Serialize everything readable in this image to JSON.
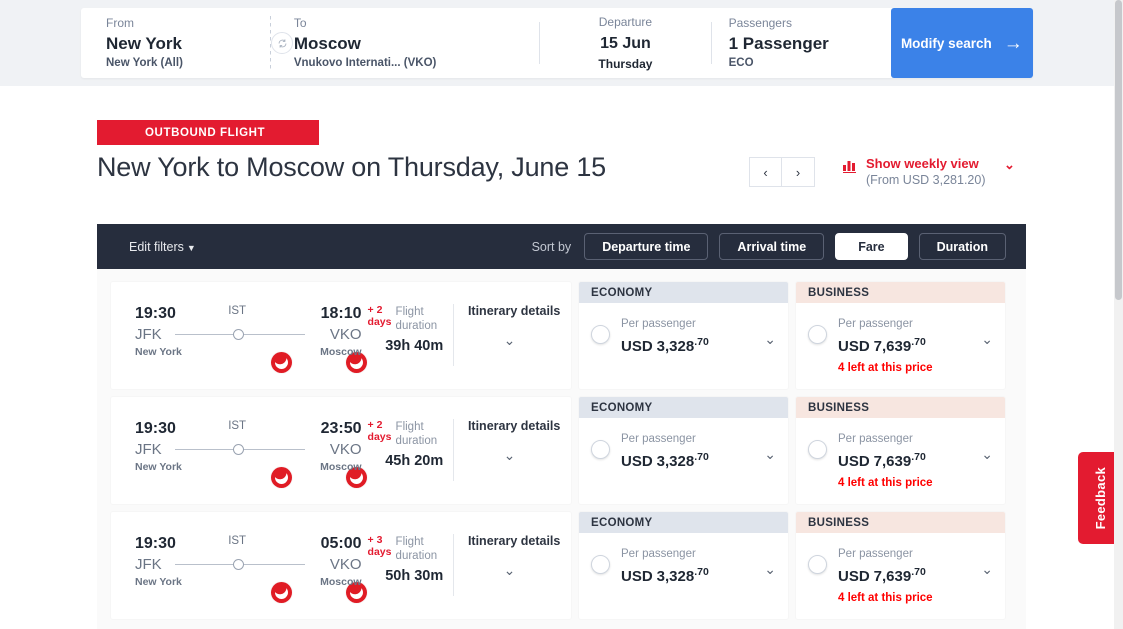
{
  "search": {
    "from_label": "From",
    "from_city": "New York",
    "from_airport": "New York (All)",
    "to_label": "To",
    "to_city": "Moscow",
    "to_airport": "Vnukovo Internati...",
    "to_code": "(VKO)",
    "swap_icon": "swap-icon",
    "departure_label": "Departure",
    "departure_day": "15",
    "departure_month": "Jun",
    "departure_weekday": "Thursday",
    "passengers_label": "Passengers",
    "passengers_value": "1 Passenger",
    "cabin_class": "ECO",
    "modify_label": "Modify search",
    "modify_arrow": "→",
    "accent_blue": "#3b82e8"
  },
  "header": {
    "badge": "OUTBOUND FLIGHT",
    "title": "New York to Moscow on Thursday, June 15",
    "prev_label": "‹",
    "next_label": "›",
    "weekly_title": "Show weekly view",
    "weekly_sub": "(From USD 3,281.20)",
    "weekly_chevron": "⌄",
    "brand_red": "#e31b30"
  },
  "toolbar": {
    "edit_filters": "Edit filters",
    "edit_filters_caret": "▼",
    "sort_by_label": "Sort by",
    "sort_options": [
      {
        "label": "Departure time",
        "active": false
      },
      {
        "label": "Arrival time",
        "active": false
      },
      {
        "label": "Fare",
        "active": true
      },
      {
        "label": "Duration",
        "active": false
      }
    ],
    "bar_bg": "#262d3d"
  },
  "flights": [
    {
      "depart_time": "19:30",
      "depart_code": "JFK",
      "depart_city": "New York",
      "connection": "IST",
      "arrive_time": "18:10",
      "arrive_code": "VKO",
      "arrive_city": "Moscow",
      "plus_days": "+ 2\ndays",
      "plus_days_num": "+ 2",
      "plus_days_unit": "days",
      "duration_label": "Flight duration",
      "duration_value": "39h 40m",
      "itinerary_label": "Itinerary details",
      "itinerary_chevron": "⌄",
      "economy": {
        "cabin": "ECONOMY",
        "per_passenger": "Per passenger",
        "currency": "USD",
        "amount": "3,328",
        "cents": ".70",
        "seats_left": ""
      },
      "business": {
        "cabin": "BUSINESS",
        "per_passenger": "Per passenger",
        "currency": "USD",
        "amount": "7,639",
        "cents": ".70",
        "seats_left": "4 left at this price"
      }
    },
    {
      "depart_time": "19:30",
      "depart_code": "JFK",
      "depart_city": "New York",
      "connection": "IST",
      "arrive_time": "23:50",
      "arrive_code": "VKO",
      "arrive_city": "Moscow",
      "plus_days_num": "+ 2",
      "plus_days_unit": "days",
      "duration_label": "Flight duration",
      "duration_value": "45h 20m",
      "itinerary_label": "Itinerary details",
      "itinerary_chevron": "⌄",
      "economy": {
        "cabin": "ECONOMY",
        "per_passenger": "Per passenger",
        "currency": "USD",
        "amount": "3,328",
        "cents": ".70",
        "seats_left": ""
      },
      "business": {
        "cabin": "BUSINESS",
        "per_passenger": "Per passenger",
        "currency": "USD",
        "amount": "7,639",
        "cents": ".70",
        "seats_left": "4 left at this price"
      }
    },
    {
      "depart_time": "19:30",
      "depart_code": "JFK",
      "depart_city": "New York",
      "connection": "IST",
      "arrive_time": "05:00",
      "arrive_code": "VKO",
      "arrive_city": "Moscow",
      "plus_days_num": "+ 3",
      "plus_days_unit": "days",
      "duration_label": "Flight duration",
      "duration_value": "50h 30m",
      "itinerary_label": "Itinerary details",
      "itinerary_chevron": "⌄",
      "economy": {
        "cabin": "ECONOMY",
        "per_passenger": "Per passenger",
        "currency": "USD",
        "amount": "3,328",
        "cents": ".70",
        "seats_left": ""
      },
      "business": {
        "cabin": "BUSINESS",
        "per_passenger": "Per passenger",
        "currency": "USD",
        "amount": "7,639",
        "cents": ".70",
        "seats_left": "4 left at this price"
      }
    }
  ],
  "feedback": {
    "label": "Feedback"
  }
}
